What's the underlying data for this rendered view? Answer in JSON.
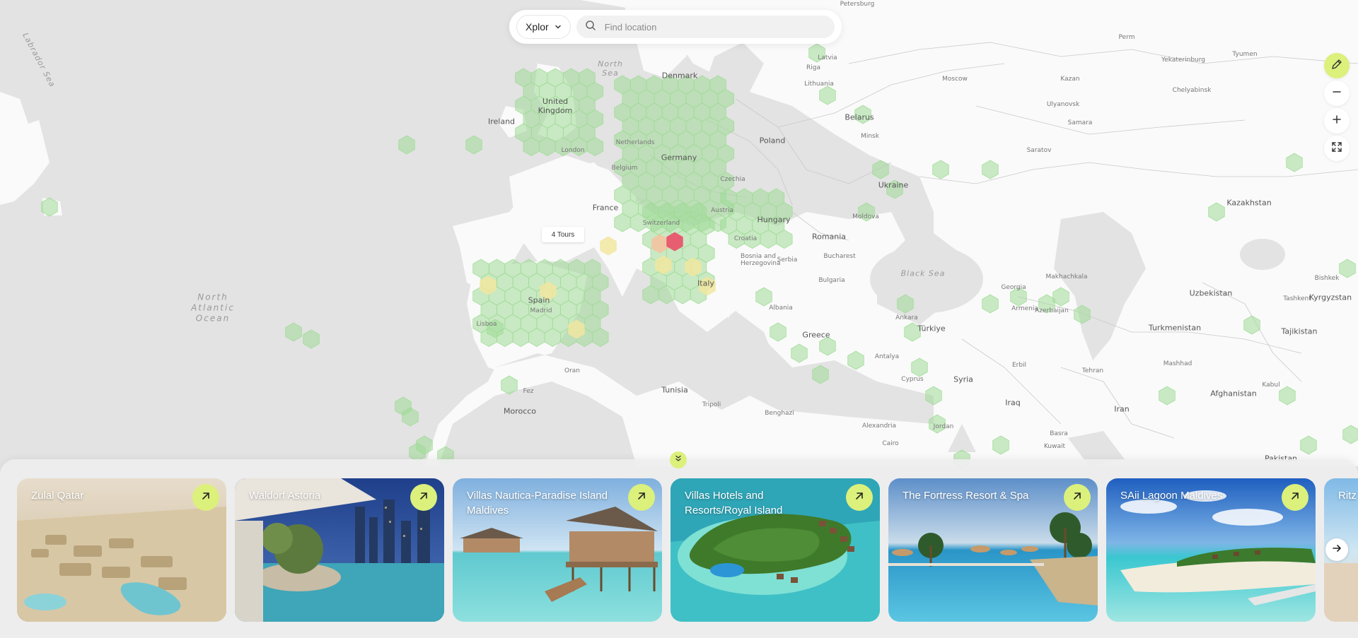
{
  "search": {
    "brand_label": "Xplor",
    "placeholder": "Find location"
  },
  "map": {
    "tooltip": "4 Tours",
    "labels": {
      "seas": {
        "labrador_sea": "Labrador Sea",
        "north_sea": "North Sea",
        "black_sea": "Black Sea",
        "north_atlantic": "North Atlantic Ocean"
      },
      "countries": {
        "ireland": "Ireland",
        "united_kingdom": "United Kingdom",
        "netherlands": "Netherlands",
        "belgium": "Belgium",
        "france": "France",
        "germany": "Germany",
        "denmark": "Denmark",
        "poland": "Poland",
        "czechia": "Czechia",
        "austria": "Austria",
        "switzerland": "Switzerland",
        "hungary": "Hungary",
        "croatia": "Croatia",
        "bosnia": "Bosnia and Herzegovina",
        "serbia": "Serbia",
        "romania": "Romania",
        "bulgaria": "Bulgaria",
        "albania": "Albania",
        "italy": "Italy",
        "spain": "Spain",
        "latvia": "Latvia",
        "lithuania": "Lithuania",
        "belarus": "Belarus",
        "ukraine": "Ukraine",
        "moldova": "Moldova",
        "greece": "Greece",
        "turkiye": "Türkiye",
        "georgia": "Georgia",
        "armenia": "Armenia",
        "azerbaijan": "Azerbaijan",
        "syria": "Syria",
        "iraq": "Iraq",
        "iran": "Iran",
        "jordan": "Jordan",
        "kazakhstan": "Kazakhstan",
        "uzbekistan": "Uzbekistan",
        "turkmenistan": "Turkmenistan",
        "kyrgyzstan": "Kyrgyzstan",
        "tajikistan": "Tajikistan",
        "afghanistan": "Afghanistan",
        "tunisia": "Tunisia",
        "morocco": "Morocco",
        "pakistan": "Pakistan"
      },
      "cities": {
        "petersburg": "Petersburg",
        "moscow": "Moscow",
        "perm": "Perm",
        "yekaterinburg": "Yekaterinburg",
        "tyumen": "Tyumen",
        "chelyabinsk": "Chelyabinsk",
        "kazan": "Kazan",
        "ulyanovsk": "Ulyanovsk",
        "samara": "Samara",
        "saratov": "Saratov",
        "madrid": "Madrid",
        "bucharest": "Bucharest",
        "ankara": "Ankara",
        "makhachkala": "Makhachkala",
        "tehran": "Tehran",
        "tashkent": "Tashkent",
        "bishkek": "Bishkek",
        "mashhad": "Mashhad",
        "kabul": "Kabul",
        "erbil": "Erbil",
        "basra": "Basra",
        "kuwait": "Kuwait",
        "fez": "Fez",
        "oran": "Oran",
        "tripoli": "Tripoli",
        "benghazi": "Benghazi",
        "alexandria": "Alexandria",
        "cairo": "Cairo",
        "antalya": "Antalya",
        "cyprus": "Cyprus",
        "lisboa": "Lisboa",
        "london": "London",
        "minsk": "Minsk",
        "riga": "Riga"
      }
    }
  },
  "cards": [
    {
      "title": "Zulal Qatar"
    },
    {
      "title": "Waldorf Astoria"
    },
    {
      "title": "Villas Nautica-Paradise Island Maldives"
    },
    {
      "title": "Villas Hotels and Resorts/Royal Island"
    },
    {
      "title": "The Fortress Resort & Spa"
    },
    {
      "title": "SAii Lagoon Maldives"
    },
    {
      "title": "Ritz"
    }
  ],
  "colors": {
    "accent": "#dcf07c",
    "hex_green": "#9fdb96",
    "hex_yellow": "#f1e6a0",
    "hex_orange": "#f4c3a1",
    "hex_red": "#e8566b",
    "land": "#fafafa",
    "water": "#e3e3e3"
  },
  "icons": {
    "brand_chevron": "chevron-down-icon",
    "search": "search-icon",
    "draw": "pencil-icon",
    "zoom_out": "minus-icon",
    "zoom_in": "plus-icon",
    "fullscreen": "expand-icon",
    "collapse": "chevrons-down-icon",
    "open_card": "arrow-up-right-icon",
    "next": "arrow-right-icon"
  }
}
